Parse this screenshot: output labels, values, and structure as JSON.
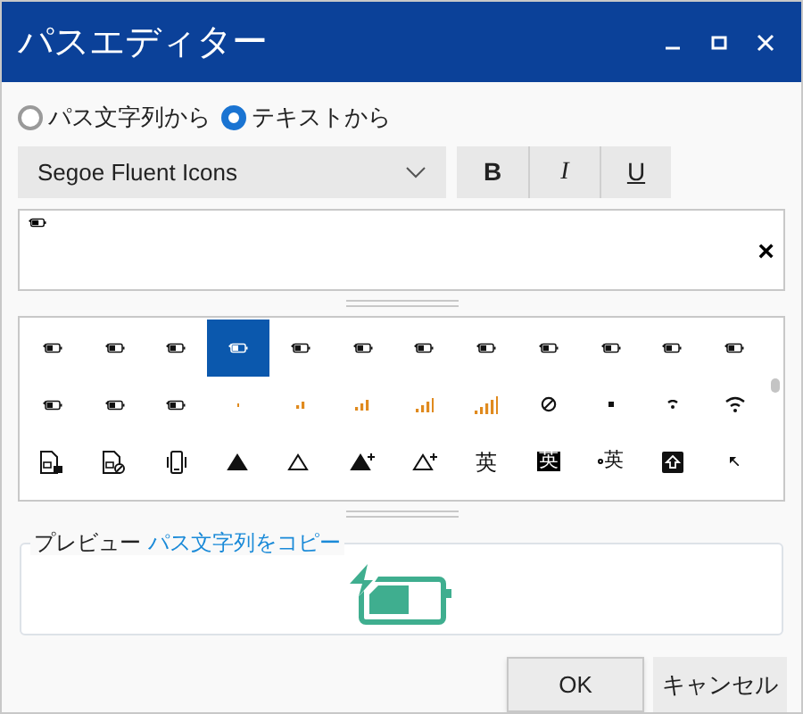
{
  "window": {
    "title": "パスエディター"
  },
  "source": [
    {
      "label": "パス文字列から",
      "selected": false
    },
    {
      "label": "テキストから",
      "selected": true
    }
  ],
  "font": {
    "value": "Segoe Fluent Icons"
  },
  "style_buttons": [
    {
      "label": "B",
      "kind": "bold"
    },
    {
      "label": "I",
      "kind": "italic"
    },
    {
      "label": "U",
      "kind": "underline"
    }
  ],
  "text_field": {
    "clear": "×"
  },
  "glyphs": [
    {
      "kind": "battery",
      "selected": false
    },
    {
      "kind": "battery",
      "selected": false
    },
    {
      "kind": "battery",
      "selected": false
    },
    {
      "kind": "battery",
      "selected": true
    },
    {
      "kind": "battery",
      "selected": false
    },
    {
      "kind": "battery",
      "selected": false
    },
    {
      "kind": "battery",
      "selected": false
    },
    {
      "kind": "battery",
      "selected": false
    },
    {
      "kind": "battery",
      "selected": false
    },
    {
      "kind": "battery",
      "selected": false
    },
    {
      "kind": "battery",
      "selected": false
    },
    {
      "kind": "battery",
      "selected": false
    },
    {
      "kind": "battery",
      "selected": false
    },
    {
      "kind": "battery",
      "selected": false
    },
    {
      "kind": "battery",
      "selected": false
    },
    {
      "kind": "signal-one",
      "selected": false
    },
    {
      "kind": "signal-two",
      "selected": false
    },
    {
      "kind": "signal-three",
      "selected": false
    },
    {
      "kind": "signal-four",
      "selected": false
    },
    {
      "kind": "signal-five",
      "selected": false
    },
    {
      "kind": "blocked",
      "selected": false
    },
    {
      "kind": "dot",
      "selected": false
    },
    {
      "kind": "wifi-weak",
      "selected": false
    },
    {
      "kind": "wifi",
      "selected": false
    },
    {
      "kind": "sim-lock",
      "selected": false
    },
    {
      "kind": "sim-blocked",
      "selected": false
    },
    {
      "kind": "phone-vibrate",
      "selected": false
    },
    {
      "kind": "triangle-filled",
      "selected": false
    },
    {
      "kind": "triangle",
      "selected": false
    },
    {
      "kind": "triangle-filled-plus",
      "selected": false
    },
    {
      "kind": "triangle-plus",
      "selected": false
    },
    {
      "kind": "ime",
      "text": "英",
      "selected": false
    },
    {
      "kind": "ime-inverted",
      "text": "英",
      "selected": false
    },
    {
      "kind": "ime-dot",
      "text": "英",
      "selected": false
    },
    {
      "kind": "shift-box",
      "selected": false
    },
    {
      "kind": "arrow",
      "selected": false
    }
  ],
  "preview": {
    "label": "プレビュー",
    "link": "パス文字列をコピー"
  },
  "buttons": [
    {
      "label": "OK",
      "kind": "default"
    },
    {
      "label": "キャンセル",
      "kind": "normal"
    }
  ]
}
